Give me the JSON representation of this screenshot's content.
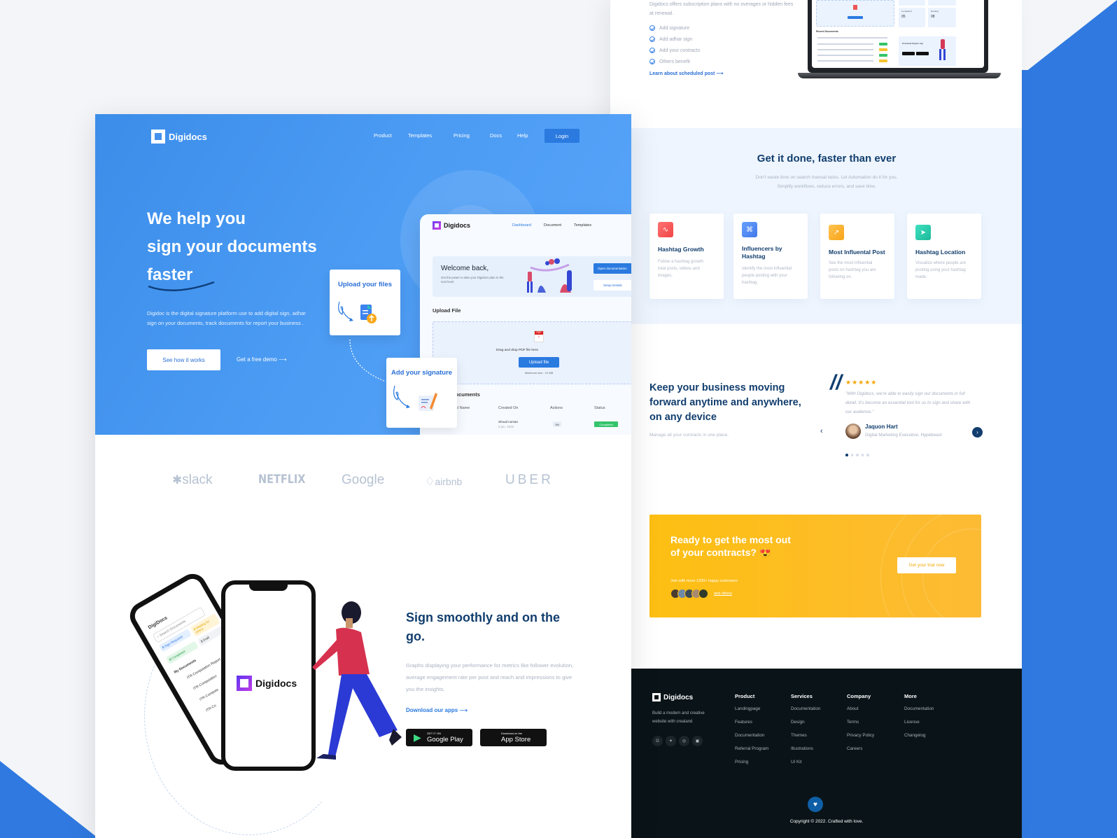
{
  "right_page": {
    "intro_text": "Digidocs offers subscription plans with no overages or hidden fees at renewal.",
    "benefits": [
      "Add signature",
      "Add adhar sign",
      "Add your contracts",
      "Others benefit"
    ],
    "learn_link": "Learn about scheduled post",
    "laptop_preview": {
      "stats": [
        {
          "label": "Completed",
          "value": "05"
        },
        {
          "label": "Pending",
          "value": "08"
        }
      ],
      "recent_label": "Recent Documents",
      "app_card_title": "Download Digidoc App"
    },
    "features": {
      "title": "Get it done, faster than ever",
      "subtitle_line1": "Don't waste time on search manual tasks. Let Automation do it for you.",
      "subtitle_line2": "Simplify workflows, reduce errors, and save time.",
      "cards": [
        {
          "icon": "pulse-icon",
          "glyph": "∿",
          "color": "#f25757",
          "title": "Hashtag Growth",
          "desc": "Follow a hashtag growth total posts, videos and images."
        },
        {
          "icon": "command-icon",
          "glyph": "⌘",
          "color": "#4c86f0",
          "title": "Influencers by Hashtag",
          "desc": "Identify the most influential people posting with your hashtag."
        },
        {
          "icon": "trend-up-icon",
          "glyph": "↗",
          "color": "#fbb330",
          "title": "Most Influental Post",
          "desc": "See the most influential posts on hashtag you are following on."
        },
        {
          "icon": "send-icon",
          "glyph": "➤",
          "color": "#23c8a8",
          "title": "Hashtag Location",
          "desc": "Visualize where people are posting using your hashtag made."
        }
      ]
    },
    "testimonial_section": {
      "title": "Keep your business moving forward anytime and anywhere, on any device",
      "subtitle": "Manage all your contracts in one place.",
      "stars": "★★★★★",
      "rating": 5,
      "quote": "\"With Digidocs, we're able to easily sign our documents in full detail. It's become an essential tool for us to sign and share with our audience.\"",
      "author": "Jaquon Hart",
      "role": "Digital Marketing Executive, Hypebeast",
      "prev": "‹",
      "next": "›",
      "dots": 5,
      "active_dot": 1
    },
    "cta": {
      "title": "Ready to get the most out of your contracts? 😍",
      "join_text": "Join with more 1200+ happy customers",
      "others_link": "and others",
      "button": "Get your trial now",
      "avatar_colors": [
        "#4a3a30",
        "#6e8aa8",
        "#3e4c5a",
        "#a88a70",
        "#2f3a2a"
      ]
    },
    "footer": {
      "brand": "Digidocs",
      "tagline": "Build a modern and creative website with crealand",
      "social": [
        {
          "icon": "google-icon",
          "glyph": "G"
        },
        {
          "icon": "twitter-icon",
          "glyph": "✦"
        },
        {
          "icon": "instagram-icon",
          "glyph": "◎"
        },
        {
          "icon": "linkedin-icon",
          "glyph": "▣"
        }
      ],
      "columns": [
        {
          "title": "Product",
          "links": [
            "Landingpage",
            "Features",
            "Documentation",
            "Referral Program",
            "Pricing"
          ]
        },
        {
          "title": "Services",
          "links": [
            "Documentation",
            "Design",
            "Themes",
            "Illustrations",
            "UI Kit"
          ]
        },
        {
          "title": "Company",
          "links": [
            "About",
            "Terms",
            "Privacy Policy",
            "Careers"
          ]
        },
        {
          "title": "More",
          "links": [
            "Documentation",
            "License",
            "Changelog"
          ]
        }
      ],
      "heart": "♥",
      "copyright": "Copyright © 2022. Crafted with love."
    }
  },
  "left_page": {
    "brand": "Digidocs",
    "nav": [
      "Product",
      "Templates",
      "Pricing",
      "Docs",
      "Help"
    ],
    "login": "Login",
    "hero": {
      "title_line1": "We help you",
      "title_line2": "sign your documents",
      "title_line3": "faster",
      "description": "Digidoc is the digital signature platform  use to add digital sign, adhar sign on your documents, track documents for report your business .",
      "primary_button": "See how it works",
      "secondary_link": "Get a free demo",
      "arrow": "⟶"
    },
    "dashboard": {
      "brand": "Digidocs",
      "tabs": [
        "Dashboard",
        "Document",
        "Templates"
      ],
      "welcome_title": "Welcome back,",
      "welcome_sub": "Get the power to take your Digidocs plan to the next level.",
      "open_button": "Open documentation",
      "setup_button": "Setup Details",
      "upload_title": "Upload File",
      "pdf_tag": "PDF",
      "drag_text": "Drag and drop PDF file here",
      "upload_button": "Upload file",
      "max_size": "Maximum size : 10 MB",
      "recent_title": "Recent Documents",
      "columns": [
        "Document Name",
        "Created On",
        "Actions",
        "Status"
      ],
      "row": {
        "created_by": "Shoud noman",
        "created_on": "5 jun, 2022",
        "action": "SN",
        "status": "Completed"
      }
    },
    "steps": [
      {
        "title": "Upload your files"
      },
      {
        "title": "Add your signature"
      }
    ],
    "logos": [
      "slack",
      "NETFLIX",
      "Google",
      "airbnb",
      "UBER"
    ],
    "app_section": {
      "title": "Sign smoothly and on the go.",
      "description": "Graphs displaying your performance for metrics like follower evolution, average engagement rate per post and reach and impressions to give you the insights.",
      "link": "Download our apps",
      "google_play_small": "GET IT ON",
      "google_play": "Google Play",
      "app_store_small": "Download on the",
      "app_store": "App Store",
      "phone_brand": "Digidocs",
      "back_phone": {
        "brand": "DigiDocs",
        "search": "Search Documents",
        "chips": [
          {
            "count": "0",
            "label": "Sign Requests"
          },
          {
            "count": "0",
            "label": "Waiting for others"
          },
          {
            "count": "8",
            "label": "Completed"
          },
          {
            "count": "2",
            "label": "Draft"
          }
        ],
        "list_title": "My Documents",
        "docs": [
          "ITR-Computation Report",
          "ITR-Computation",
          "ITR-Computa",
          "ITR-Co"
        ]
      }
    }
  }
}
